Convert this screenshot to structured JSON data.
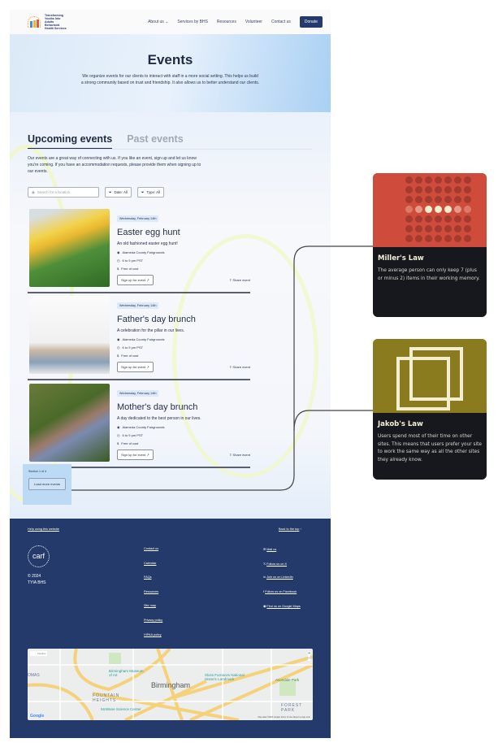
{
  "header": {
    "logo_text": "Transforming Youths Into Adults Behavioral Health Services",
    "nav": [
      "About us",
      "Services by BHS",
      "Resources",
      "Volunteer",
      "Contact us"
    ],
    "donate": "Donate"
  },
  "hero": {
    "title": "Events",
    "text": "We organize events for our clients to interact with staff in a more social setting. This helps us build a strong community based on trust and friendship. It also allows us to better understand our clients."
  },
  "tabs": {
    "upcoming": "Upcoming events",
    "past": "Past events"
  },
  "intro": "Our events are a great way of connecting with us. If you like an event, sign up and let us know you're coming. If you have an accommodation requests, please provide them when signing up to our events.",
  "filters": {
    "search_placeholder": "Search for a location",
    "date": "Date: All",
    "type": "Type: All"
  },
  "events": [
    {
      "date": "Wednesday, February 14th",
      "title": "Easter egg hunt",
      "desc": "An old fashioned easter egg hunt!",
      "location": "Alameda County Fairgrounds",
      "time": "6 to 9 pm PST",
      "cost": "Free of cost",
      "signup": "Sign up for event",
      "share": "Share event"
    },
    {
      "date": "Wednesday, February 14th",
      "title": "Father's day brunch",
      "desc": "A celebration for the pillar in our lives.",
      "location": "Alameda County Fairgrounds",
      "time": "6 to 9 pm PST",
      "cost": "Free of cost",
      "signup": "Sign up for event",
      "share": "Share event"
    },
    {
      "date": "Wednesday, February 14th",
      "title": "Mother's day brunch",
      "desc": "A day dedicated to the best person in our lives.",
      "location": "Alameda County Fairgrounds",
      "time": "6 to 9 pm PST",
      "cost": "Free of cost",
      "signup": "Sign up for event",
      "share": "Share event"
    }
  ],
  "pagination": {
    "section": "Section 1 of 4",
    "load_more": "Load more events"
  },
  "footer": {
    "help": "Help using this website",
    "back_top": "Back to the top",
    "logo_text": "carf",
    "copyright": "© 2024",
    "org": "TYIA BHS",
    "links": [
      "Contact us",
      "Calendar",
      "FAQs",
      "Resources",
      "Site map",
      "Privacy policy",
      "HIPAA policy"
    ],
    "social": [
      "Mail us",
      "Follow us on X",
      "Join us on LinkedIn",
      "Follow us on Facebook",
      "Find us on Google Maps"
    ]
  },
  "map": {
    "tabs": [
      "Map",
      "Satellite"
    ],
    "labels": [
      "Birmingham",
      "Birmingham Museum of Art",
      "Sloss Furnaces National Historic Landmark",
      "Avondale Park",
      "FOUNTAIN HEIGHTS",
      "McWane Science Center",
      "FOREST PARK",
      "OMAS"
    ],
    "attribution": "Map data ©2024 Google   Terms of Use   Report a map error"
  },
  "laws": [
    {
      "title": "Miller's Law",
      "text": "The average person can only keep 7 (plus or minus 2) items in their working memory.",
      "color": "#cf4b3c"
    },
    {
      "title": "Jakob's Law",
      "text": "Users spend most of their time on other sites. This means that users prefer your site to work the same way as all the other sites they already know.",
      "color": "#8a7c1e"
    }
  ]
}
